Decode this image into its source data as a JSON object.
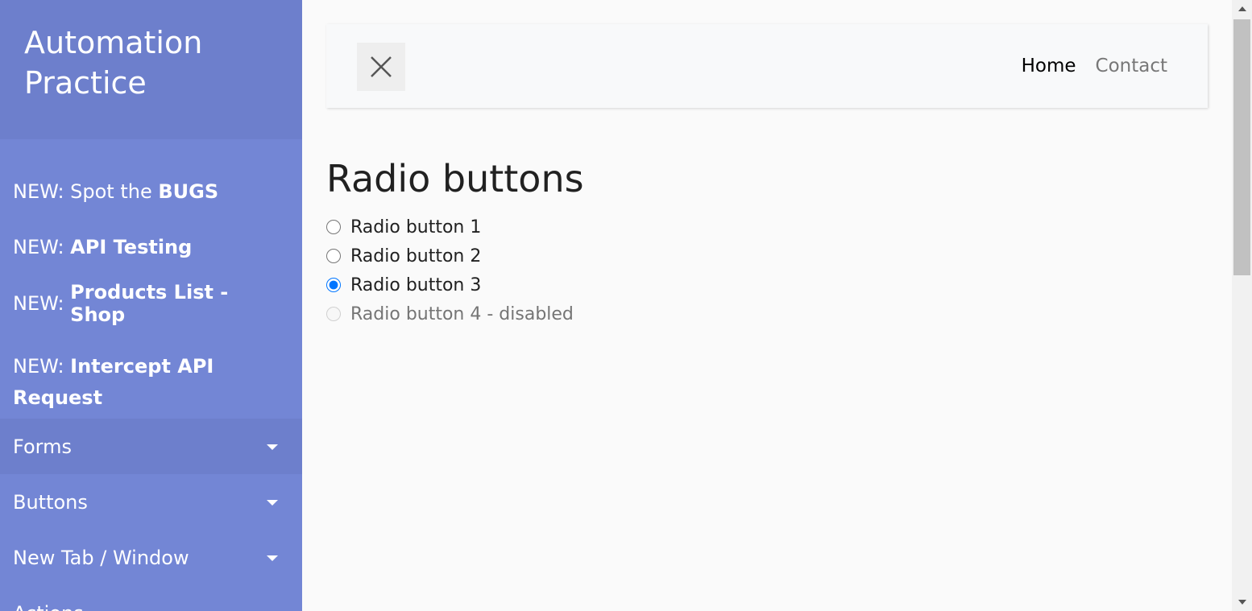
{
  "sidebar": {
    "brand_line1": "Automation",
    "brand_line2": "Practice",
    "new_items": [
      {
        "prefix": "NEW: Spot the ",
        "bold": "BUGS"
      },
      {
        "prefix": "NEW: ",
        "bold": "API Testing"
      },
      {
        "prefix": "NEW: ",
        "bold": "Products List - Shop"
      },
      {
        "prefix": "NEW: ",
        "bold": "Intercept API Request"
      }
    ],
    "dropdowns": [
      {
        "label": "Forms",
        "active": true
      },
      {
        "label": "Buttons",
        "active": false
      },
      {
        "label": "New Tab / Window",
        "active": false
      },
      {
        "label": "Actions",
        "active": false
      }
    ]
  },
  "navbar": {
    "toggle_icon": "close-icon",
    "links": [
      {
        "label": "Home",
        "current": true
      },
      {
        "label": "Contact",
        "current": false
      }
    ]
  },
  "main": {
    "title": "Radio buttons",
    "radios": [
      {
        "label": "Radio button 1",
        "checked": false,
        "disabled": false
      },
      {
        "label": "Radio button 2",
        "checked": false,
        "disabled": false
      },
      {
        "label": "Radio button 3",
        "checked": true,
        "disabled": false
      },
      {
        "label": "Radio button 4 - disabled",
        "checked": false,
        "disabled": true
      }
    ]
  },
  "colors": {
    "sidebar_bg": "#7386d5",
    "sidebar_header_bg": "#6d7fcc",
    "radio_accent": "#0075ff"
  }
}
